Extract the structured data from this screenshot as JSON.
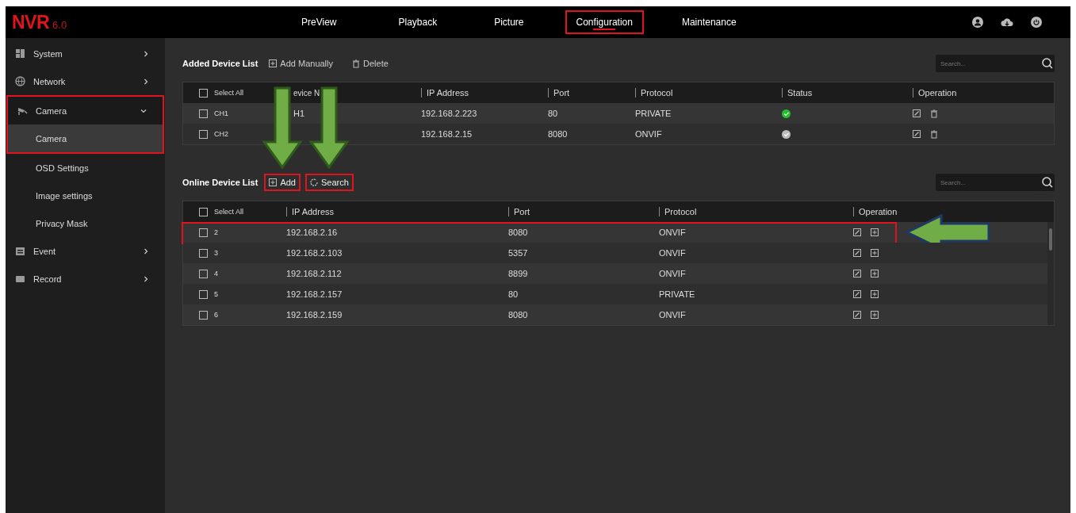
{
  "header": {
    "logo": "NVR",
    "version": "6.0",
    "nav": [
      {
        "label": "PreView",
        "selected": false,
        "highlighted": false
      },
      {
        "label": "Playback",
        "selected": false,
        "highlighted": false
      },
      {
        "label": "Picture",
        "selected": false,
        "highlighted": false
      },
      {
        "label": "Configuration",
        "selected": true,
        "highlighted": true
      },
      {
        "label": "Maintenance",
        "selected": false,
        "highlighted": false
      }
    ]
  },
  "sidebar": {
    "items": [
      {
        "label": "System",
        "kind": "system",
        "expanded": false,
        "highlighted": false
      },
      {
        "label": "Network",
        "kind": "network",
        "expanded": false,
        "highlighted": false
      },
      {
        "label": "Camera",
        "kind": "camera",
        "expanded": true,
        "highlighted": true,
        "children": [
          {
            "label": "Camera",
            "selected": true
          },
          {
            "label": "OSD Settings",
            "selected": false
          },
          {
            "label": "Image settings",
            "selected": false
          },
          {
            "label": "Privacy Mask",
            "selected": false
          }
        ]
      },
      {
        "label": "Event",
        "kind": "event",
        "expanded": false,
        "highlighted": false
      },
      {
        "label": "Record",
        "kind": "record",
        "expanded": false,
        "highlighted": false
      }
    ]
  },
  "added_devices": {
    "title": "Added Device List",
    "actions": [
      {
        "label": "Add Manually",
        "kind": "add",
        "highlighted": false,
        "arrow_pointed": false
      },
      {
        "label": "Delete",
        "kind": "delete",
        "highlighted": false,
        "arrow_pointed": false
      }
    ],
    "search": {
      "placeholder": "Search..."
    },
    "select_all_checked": false,
    "columns": [
      "Select All",
      "evice N",
      "IP Address",
      "Port",
      "Protocol",
      "Status",
      "Operation"
    ],
    "rows": [
      {
        "checked": false,
        "cells": [
          "CH1",
          "H1",
          "192.168.2.223",
          "80",
          "PRIVATE"
        ],
        "color": "#22c02a"
      },
      {
        "checked": false,
        "cells": [
          "CH2",
          "",
          "192.168.2.15",
          "8080",
          "ONVIF"
        ],
        "color": "#bbbbbb"
      }
    ]
  },
  "online_devices": {
    "title": "Online Device List",
    "actions": [
      {
        "label": "Add",
        "kind": "add",
        "highlighted": true,
        "arrow_pointed": true
      },
      {
        "label": "Search",
        "kind": "refresh",
        "highlighted": true,
        "arrow_pointed": true
      }
    ],
    "search": {
      "placeholder": "Search..."
    },
    "select_all_checked": false,
    "columns": [
      "Select All",
      "IP Address",
      "Port",
      "Protocol",
      "Operation"
    ],
    "rows": [
      {
        "checked": false,
        "highlighted": true,
        "cells": [
          "2",
          "192.168.2.16",
          "8080",
          "ONVIF"
        ]
      },
      {
        "checked": false,
        "highlighted": false,
        "cells": [
          "3",
          "192.168.2.103",
          "5357",
          "ONVIF"
        ]
      },
      {
        "checked": false,
        "highlighted": false,
        "cells": [
          "4",
          "192.168.2.112",
          "8899",
          "ONVIF"
        ]
      },
      {
        "checked": false,
        "highlighted": false,
        "cells": [
          "5",
          "192.168.2.157",
          "80",
          "PRIVATE"
        ]
      },
      {
        "checked": false,
        "highlighted": false,
        "cells": [
          "6",
          "192.168.2.159",
          "8080",
          "ONVIF"
        ]
      }
    ]
  }
}
